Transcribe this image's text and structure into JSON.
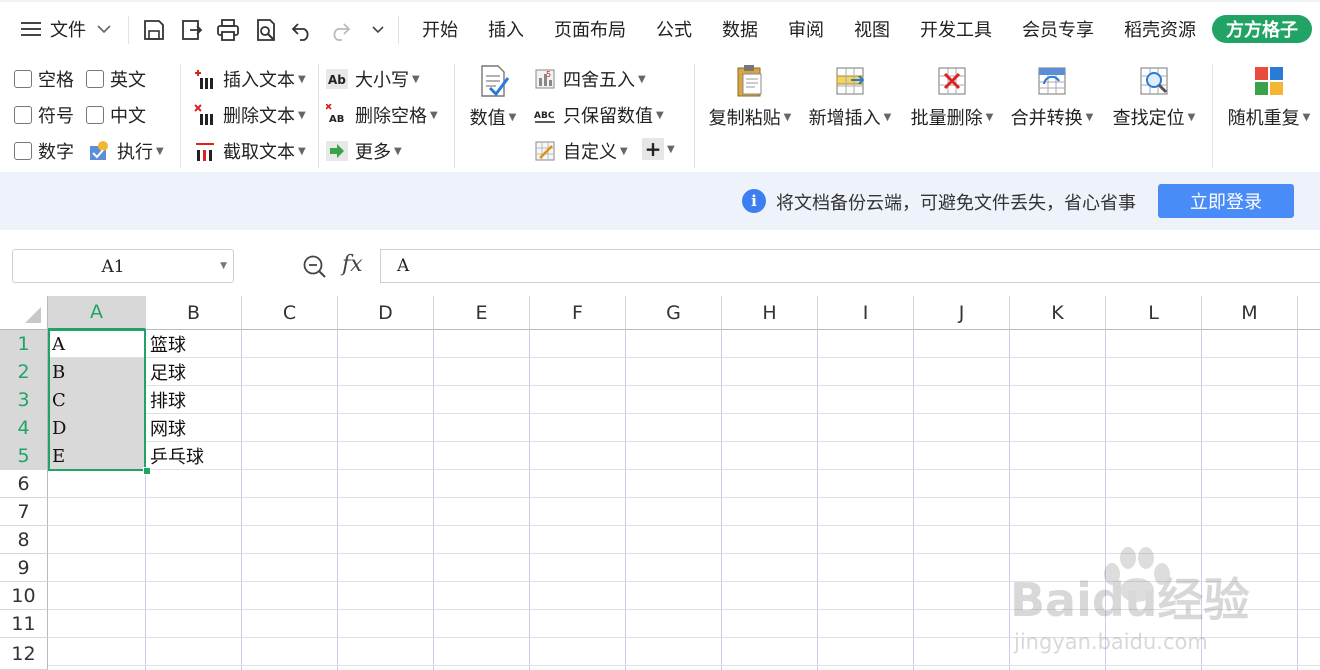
{
  "menubar": {
    "file_label": "文件",
    "tabs": [
      "开始",
      "插入",
      "页面布局",
      "公式",
      "数据",
      "审阅",
      "视图",
      "开发工具",
      "会员专享",
      "稻壳资源"
    ],
    "addon_tab": "方方格子"
  },
  "ribbon": {
    "checkboxes": [
      "空格",
      "英文",
      "符号",
      "中文",
      "数字"
    ],
    "execute": "执行",
    "text_ops": [
      "插入文本",
      "删除文本",
      "截取文本"
    ],
    "case_ops": [
      "大小写",
      "删除空格",
      "更多"
    ],
    "numeric_label": "数值",
    "number_ops": [
      "四舍五入",
      "只保留数值",
      "自定义"
    ],
    "plus": "+",
    "big_buttons": [
      "复制粘贴",
      "新增插入",
      "批量删除",
      "合并转换",
      "查找定位",
      "随机重复"
    ]
  },
  "infobar": {
    "icon_glyph": "i",
    "message": "将文档备份云端，可避免文件丢失，省心省事",
    "login_button": "立即登录"
  },
  "formula": {
    "name_box": "A1",
    "fx": "fx",
    "content": "A"
  },
  "sheet": {
    "columns": [
      "A",
      "B",
      "C",
      "D",
      "E",
      "F",
      "G",
      "H",
      "I",
      "J",
      "K",
      "L",
      "M"
    ],
    "rows": [
      "1",
      "2",
      "3",
      "4",
      "5",
      "6",
      "7",
      "8",
      "9",
      "10",
      "11",
      "12"
    ],
    "col_a": [
      "A",
      "B",
      "C",
      "D",
      "E"
    ],
    "col_b": [
      "篮球",
      "足球",
      "排球",
      "网球",
      "乒乓球"
    ]
  },
  "watermark": {
    "brand": "Baidu经验",
    "url": "jingyan.baidu.com"
  },
  "colors": {
    "accent_green": "#21a366",
    "login_blue": "#4a8cf7",
    "info_bg": "#eef3fb",
    "selection_fill": "#d9d9d9"
  }
}
